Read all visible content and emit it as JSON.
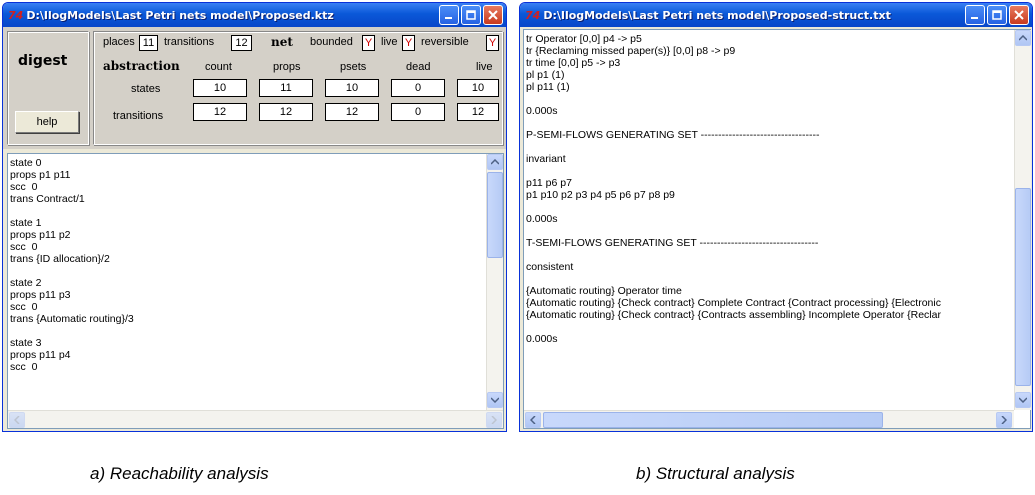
{
  "left_window": {
    "title": "D:\\IlogModels\\Last Petri nets model\\Proposed.ktz",
    "logo": "74",
    "digest_label": "digest",
    "help_label": "help",
    "places_label": "places",
    "places_value": "11",
    "transitions_label": "transitions",
    "transitions_value": "12",
    "net_label": "net",
    "bounded_label": "bounded",
    "bounded_value": "Y",
    "live_label": "live",
    "live_value": "Y",
    "reversible_label": "reversible",
    "reversible_value": "Y",
    "abstraction_label": "abstraction",
    "columns": [
      "count",
      "props",
      "psets",
      "dead",
      "live"
    ],
    "rows": [
      {
        "label": "states",
        "values": [
          "10",
          "11",
          "10",
          "0",
          "10"
        ]
      },
      {
        "label": "transitions",
        "values": [
          "12",
          "12",
          "12",
          "0",
          "12"
        ]
      }
    ],
    "text_lines": [
      "state 0",
      "props p1 p11",
      "scc  0",
      "trans Contract/1",
      "",
      "state 1",
      "props p11 p2",
      "scc  0",
      "trans {ID allocation}/2",
      "",
      "state 2",
      "props p11 p3",
      "scc  0",
      "trans {Automatic routing}/3",
      "",
      "state 3",
      "props p11 p4",
      "scc  0"
    ]
  },
  "right_window": {
    "title": "D:\\IlogModels\\Last Petri nets model\\Proposed-struct.txt",
    "logo": "74",
    "text_lines": [
      "tr Operator [0,0] p4 -> p5",
      "tr {Reclaming missed paper(s)} [0,0] p8 -> p9",
      "tr time [0,0] p5 -> p3",
      "pl p1 (1)",
      "pl p11 (1)",
      "",
      "0.000s",
      "",
      "P-SEMI-FLOWS GENERATING SET ----------------------------------",
      "",
      "invariant",
      "",
      "p11 p6 p7",
      "p1 p10 p2 p3 p4 p5 p6 p7 p8 p9",
      "",
      "0.000s",
      "",
      "T-SEMI-FLOWS GENERATING SET ----------------------------------",
      "",
      "consistent",
      "",
      "{Automatic routing} Operator time",
      "{Automatic routing} {Check contract} Complete Contract {Contract processing} {Electronic",
      "{Automatic routing} {Check contract} {Contracts assembling} Incomplete Operator {Reclar",
      "",
      "0.000s"
    ]
  },
  "captions": {
    "left": "a) Reachability analysis",
    "right": "b) Structural analysis"
  },
  "colors": {
    "titlebar": "#0a58d8",
    "close_button": "#c83a1e",
    "flag_red": "#d00000"
  }
}
